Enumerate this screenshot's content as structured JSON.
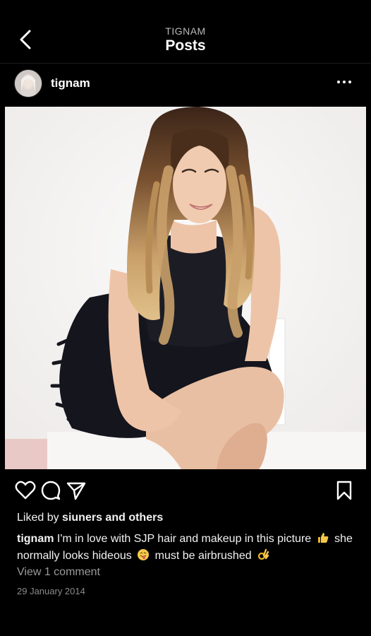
{
  "header": {
    "subtitle": "TIGNAM",
    "title": "Posts"
  },
  "post": {
    "username": "tignam",
    "likes": {
      "prefix": "Liked by",
      "user": "siuners",
      "connector": "and",
      "others": "others"
    },
    "caption": {
      "username": "tignam",
      "part1": "I'm in love with SJP hair and makeup in this picture",
      "part2": "she normally looks hideous",
      "part3": "must be airbrushed"
    },
    "view_comments": "View 1 comment",
    "date": "29 January 2014"
  },
  "icons": {
    "back": "chevron-left-icon",
    "more": "more-horizontal-icon",
    "like": "heart-icon",
    "comment": "comment-bubble-icon",
    "share": "paper-plane-icon",
    "save": "bookmark-icon",
    "emoji1": "thumbs-up-emoji",
    "emoji2": "tongue-out-face-emoji",
    "emoji3": "ok-hand-emoji"
  },
  "colors": {
    "background": "#000000",
    "text": "#ffffff",
    "muted": "#9a9a9a"
  }
}
